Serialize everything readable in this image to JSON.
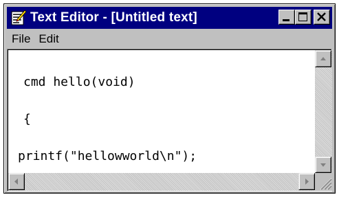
{
  "window": {
    "title": "Text Editor - [Untitled text]"
  },
  "title_buttons": {
    "minimize_icon": "minimize-icon",
    "maximize_icon": "maximize-icon",
    "close_icon": "close-icon"
  },
  "menu": {
    "items": [
      {
        "label": "File"
      },
      {
        "label": "Edit"
      }
    ]
  },
  "editor": {
    "lines": [
      "cmd hello(void)",
      "{",
      "printf(\"hellowworld\\n\");",
      "}"
    ]
  },
  "colors": {
    "titlebar": "#000080",
    "title_text": "#ffffff",
    "face": "#c0c0c0",
    "editor_bg": "#ffffff"
  }
}
